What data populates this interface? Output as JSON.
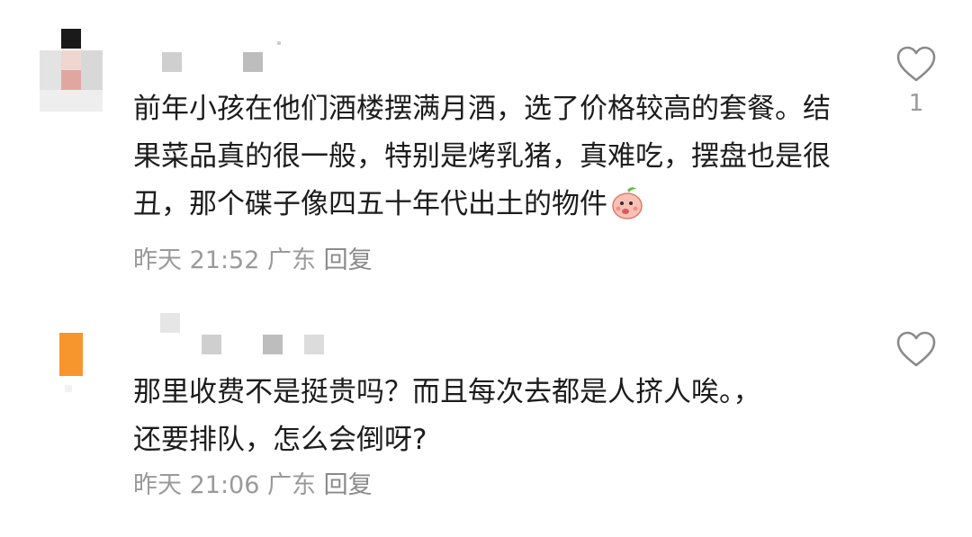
{
  "comments": [
    {
      "text": "前年小孩在他们酒楼摆满月酒，选了价格较高的套餐。结果菜品真的很一般，特别是烤乳猪，真难吃，摆盘也是很丑，那个碟子像四五十年代出土的物件",
      "emoji": "peach-emoji",
      "time": "昨天 21:52",
      "location": "广东",
      "reply_label": "回复",
      "like_count": "1"
    },
    {
      "text": "那里收费不是挺贵吗？而且每次去都是人挤人唉。，还要排队，怎么会倒呀?",
      "time": "昨天 21:06",
      "location": "广东",
      "reply_label": "回复",
      "like_count": ""
    }
  ],
  "icons": {
    "like": "heart-icon"
  },
  "colors": {
    "text": "#1c1c1c",
    "meta": "#9a9a9a",
    "avatar2_accent": "#f8962e"
  }
}
